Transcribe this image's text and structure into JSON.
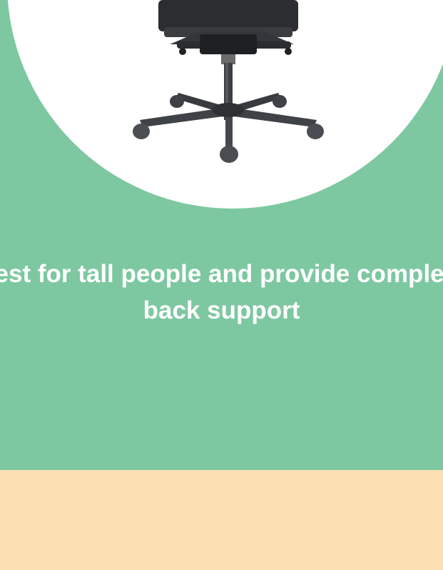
{
  "hero": {
    "product_image_alt": "office chair base",
    "headline": "Best for tall people and provide complete back support"
  },
  "colors": {
    "green_background": "#7dc8a1",
    "peach_background": "#fcdfb3",
    "circle_background": "#ffffff",
    "headline_text": "#ffffff"
  }
}
